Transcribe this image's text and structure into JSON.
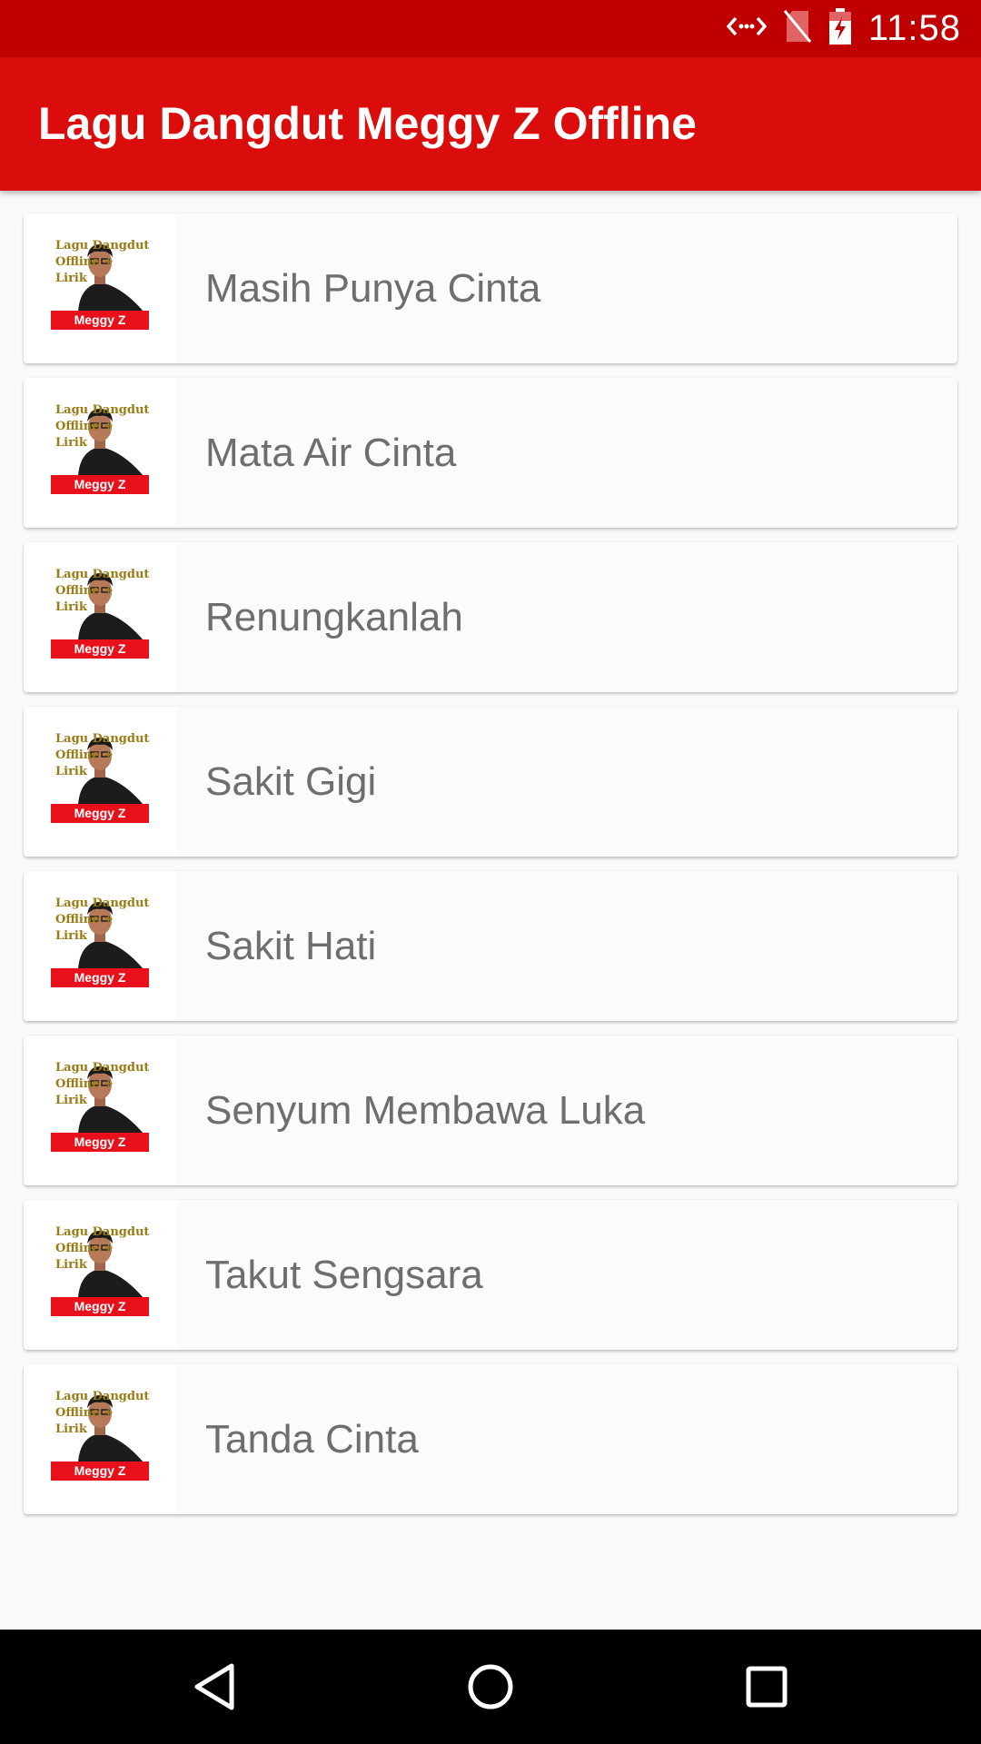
{
  "status_bar": {
    "time": "11:58",
    "icons": [
      "data-transfer-icon",
      "no-sim-icon",
      "battery-charging-icon"
    ]
  },
  "app_bar": {
    "title": "Lagu Dangdut Meggy Z Offline"
  },
  "thumbnail": {
    "line1": "Lagu Dangdut",
    "line2": "Offline +",
    "line3": "Lirik",
    "artist": "Meggy Z"
  },
  "songs": [
    {
      "title": "Masih Punya Cinta"
    },
    {
      "title": "Mata Air Cinta"
    },
    {
      "title": "Renungkanlah"
    },
    {
      "title": "Sakit Gigi"
    },
    {
      "title": "Sakit Hati"
    },
    {
      "title": "Senyum Membawa Luka"
    },
    {
      "title": "Takut Sengsara"
    },
    {
      "title": "Tanda Cinta"
    }
  ],
  "nav_bar": {
    "icons": [
      "back-icon",
      "home-icon",
      "recents-icon"
    ]
  },
  "colors": {
    "status_bar": "#c00000",
    "app_bar": "#db0c0c",
    "background": "#faf9fb",
    "song_text": "#6e6e6e"
  }
}
